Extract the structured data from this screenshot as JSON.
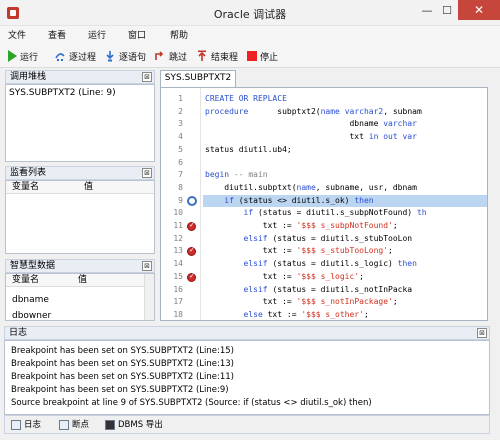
{
  "window": {
    "title": "Oracle 调试器",
    "minimize": "—",
    "maximize": "☐",
    "close": "✕"
  },
  "menu": [
    "文件",
    "查看",
    "运行",
    "窗口",
    "帮助"
  ],
  "toolbar": {
    "run": "运行",
    "step_over": "逐过程",
    "step_into": "逐语句",
    "jump": "跳过",
    "step_out": "结束程",
    "stop": "停止"
  },
  "call_stack": {
    "title": "调用堆栈",
    "close": "⊠",
    "items": [
      "SYS.SUBPTXT2 (Line: 9)"
    ]
  },
  "watch": {
    "title": "监看列表",
    "close": "⊠",
    "col_name": "变量名",
    "col_value": "值"
  },
  "smart": {
    "title": "智慧型数据",
    "close": "⊠",
    "col_name": "变量名",
    "col_value": "值",
    "rows": [
      "dbname",
      "dbowner"
    ]
  },
  "editor": {
    "tab": "SYS.SUBPTXT2",
    "line_numbers": [
      "1",
      "2",
      "3",
      "4",
      "5",
      "6",
      "7",
      "8",
      "9",
      "10",
      "11",
      "12",
      "13",
      "14",
      "15",
      "16",
      "17",
      "18"
    ],
    "lines": [
      [
        {
          "t": "CREATE OR REPLACE",
          "c": "kw"
        }
      ],
      [
        {
          "t": "procedure      ",
          "c": "kw"
        },
        {
          "t": "subptxt2(",
          "c": ""
        },
        {
          "t": "name varchar2",
          "c": "kw"
        },
        {
          "t": ", subnam",
          "c": ""
        }
      ],
      [
        {
          "t": "                              dbname ",
          "c": ""
        },
        {
          "t": "varchar",
          "c": "kw"
        }
      ],
      [
        {
          "t": "                              txt ",
          "c": ""
        },
        {
          "t": "in out var",
          "c": "kw"
        }
      ],
      [
        {
          "t": "status diutil.ub4;",
          "c": ""
        }
      ],
      [
        {
          "t": "",
          "c": ""
        }
      ],
      [
        {
          "t": "begin ",
          "c": "kw"
        },
        {
          "t": "-- main",
          "c": "cm"
        }
      ],
      [
        {
          "t": "    diutil.subptxt(",
          "c": ""
        },
        {
          "t": "name",
          "c": "kw"
        },
        {
          "t": ", subname, usr, dbnam",
          "c": ""
        }
      ],
      [
        {
          "t": "    ",
          "c": ""
        },
        {
          "t": "if",
          "c": "kw"
        },
        {
          "t": " (status <> diutil.s_ok) ",
          "c": ""
        },
        {
          "t": "then",
          "c": "kw"
        }
      ],
      [
        {
          "t": "        ",
          "c": ""
        },
        {
          "t": "if",
          "c": "kw"
        },
        {
          "t": " (status = diutil.s_subpNotFound) ",
          "c": ""
        },
        {
          "t": "th",
          "c": "kw"
        }
      ],
      [
        {
          "t": "            txt := ",
          "c": ""
        },
        {
          "t": "'$$$ s_subpNotFound'",
          "c": "str"
        },
        {
          "t": ";",
          "c": ""
        }
      ],
      [
        {
          "t": "        ",
          "c": ""
        },
        {
          "t": "elsif",
          "c": "kw"
        },
        {
          "t": " (status = diutil.s_stubTooLon",
          "c": ""
        }
      ],
      [
        {
          "t": "            txt := ",
          "c": ""
        },
        {
          "t": "'$$$ s_stubTooLong'",
          "c": "str"
        },
        {
          "t": ";",
          "c": ""
        }
      ],
      [
        {
          "t": "        ",
          "c": ""
        },
        {
          "t": "elsif",
          "c": "kw"
        },
        {
          "t": " (status = diutil.s_logic) ",
          "c": ""
        },
        {
          "t": "then",
          "c": "kw"
        }
      ],
      [
        {
          "t": "            txt := ",
          "c": ""
        },
        {
          "t": "'$$$ s_logic'",
          "c": "str"
        },
        {
          "t": ";",
          "c": ""
        }
      ],
      [
        {
          "t": "        ",
          "c": ""
        },
        {
          "t": "elsif",
          "c": "kw"
        },
        {
          "t": " (status = diutil.s_notInPacka",
          "c": ""
        }
      ],
      [
        {
          "t": "            txt := ",
          "c": ""
        },
        {
          "t": "'$$$ s_notInPackage'",
          "c": "str"
        },
        {
          "t": ";",
          "c": ""
        }
      ],
      [
        {
          "t": "        ",
          "c": ""
        },
        {
          "t": "else",
          "c": "kw"
        },
        {
          "t": " txt := ",
          "c": ""
        },
        {
          "t": "'$$$ s_other'",
          "c": "str"
        },
        {
          "t": ";",
          "c": ""
        }
      ]
    ],
    "breakpoint_lines": [
      11,
      13,
      15
    ],
    "current_line": 9
  },
  "log": {
    "title": "日志",
    "close": "⊠",
    "lines": [
      "Breakpoint has been set on SYS.SUBPTXT2 (Line:15)",
      "Breakpoint has been set on SYS.SUBPTXT2 (Line:13)",
      "Breakpoint has been set on SYS.SUBPTXT2 (Line:11)",
      "Breakpoint has been set on SYS.SUBPTXT2 (Line:9)",
      "Source breakpoint at line 9 of SYS.SUBPTXT2 (Source:     if (status <> diutil.s_ok) then)"
    ]
  },
  "bottom_tabs": [
    "日志",
    "断点",
    "DBMS 导出"
  ]
}
